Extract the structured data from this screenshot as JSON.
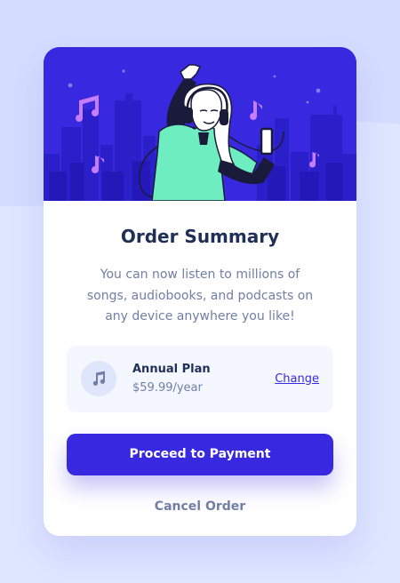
{
  "order": {
    "title": "Order Summary",
    "description": "You can now listen to millions of songs, audiobooks, and podcasts on any device anywhere you like!"
  },
  "plan": {
    "name": "Annual Plan",
    "price": "$59.99/year",
    "change_label": "Change",
    "icon": "music-note-icon"
  },
  "actions": {
    "proceed_label": "Proceed to Payment",
    "cancel_label": "Cancel Order"
  },
  "colors": {
    "accent": "#3829e0",
    "background": "#dfe6ff",
    "title": "#1f2f56",
    "muted": "#717fa6"
  }
}
